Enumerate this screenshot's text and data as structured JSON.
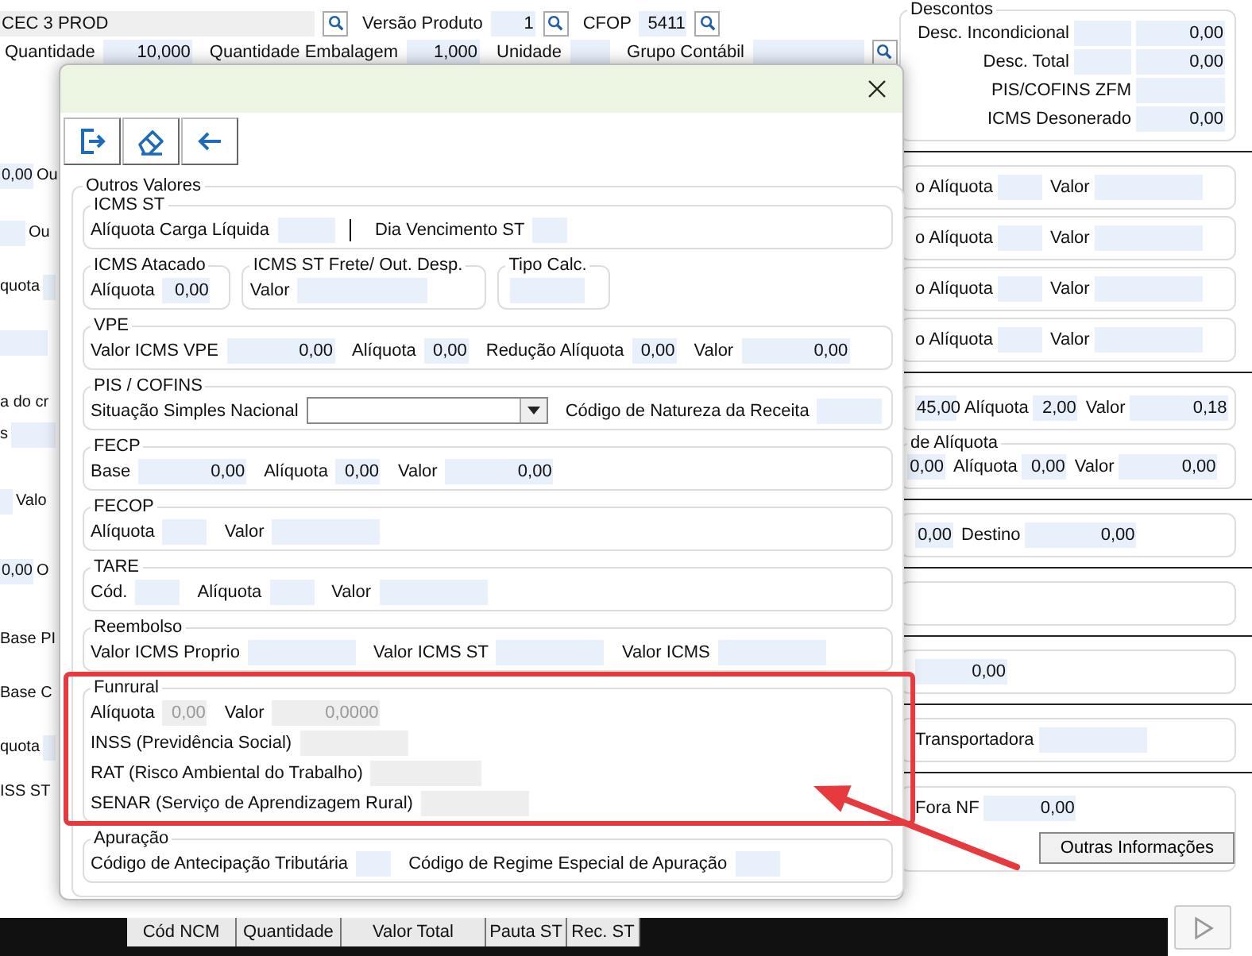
{
  "top_rows": [
    [
      {
        "kind": "field",
        "value": "CEC 3 PROD"
      },
      {
        "kind": "search"
      },
      {
        "kind": "label",
        "text": "Versão Produto"
      },
      {
        "kind": "field",
        "value": "1"
      },
      {
        "kind": "search"
      },
      {
        "kind": "label",
        "text": "CFOP"
      },
      {
        "kind": "field",
        "value": "5411"
      },
      {
        "kind": "search"
      }
    ],
    [
      {
        "kind": "label",
        "text": "Quantidade"
      },
      {
        "kind": "field",
        "value": "10,000"
      },
      {
        "kind": "label",
        "text": "Quantidade Embalagem"
      },
      {
        "kind": "field",
        "value": "1,000"
      },
      {
        "kind": "label",
        "text": "Unidade"
      },
      {
        "kind": "field"
      },
      {
        "kind": "label",
        "text": "Grupo Contábil"
      },
      {
        "kind": "field"
      },
      {
        "kind": "search"
      }
    ]
  ],
  "left_strip": [
    [
      {
        "kind": "field",
        "value": "0,00"
      },
      {
        "kind": "label",
        "text": "Ou"
      }
    ],
    [
      {
        "kind": "field"
      },
      {
        "kind": "label",
        "text": "Ou"
      }
    ],
    [
      {
        "kind": "label",
        "text": "quota"
      },
      {
        "kind": "field"
      }
    ],
    [
      {
        "kind": "field"
      }
    ],
    [
      {
        "kind": "label",
        "text": "a do cr"
      }
    ],
    [
      {
        "kind": "label",
        "text": "s"
      },
      {
        "kind": "field"
      }
    ],
    [
      {
        "kind": "field"
      },
      {
        "kind": "label",
        "text": "Valo"
      }
    ],
    [
      {
        "kind": "field",
        "value": "0,00"
      },
      {
        "kind": "label",
        "text": "O"
      }
    ],
    [
      {
        "kind": "label",
        "text": "Base PI"
      }
    ],
    [
      {
        "kind": "label",
        "text": "Base C"
      }
    ],
    [
      {
        "kind": "label",
        "text": "quota"
      },
      {
        "kind": "field"
      }
    ],
    [
      {
        "kind": "label",
        "text": "ISS ST"
      }
    ]
  ],
  "right_panel": [
    {
      "kind": "group",
      "title": "Descontos",
      "rows": [
        [
          {
            "kind": "label",
            "text": "Desc. Incondicional"
          },
          {
            "kind": "field"
          },
          {
            "kind": "field",
            "value": "0,00"
          }
        ],
        [
          {
            "kind": "label",
            "text": "Desc. Total"
          },
          {
            "kind": "field"
          },
          {
            "kind": "field",
            "value": "0,00"
          }
        ],
        [
          {
            "kind": "label",
            "text": "PIS/COFINS ZFM"
          },
          {
            "kind": "field"
          }
        ],
        [
          {
            "kind": "label",
            "text": "ICMS Desonerado"
          },
          {
            "kind": "field",
            "value": "0,00"
          }
        ]
      ]
    },
    {
      "kind": "rule"
    },
    {
      "kind": "box",
      "rows": [
        [
          {
            "kind": "label",
            "text": "o Alíquota"
          },
          {
            "kind": "field"
          },
          {
            "kind": "label",
            "text": "Valor"
          },
          {
            "kind": "field"
          }
        ]
      ]
    },
    {
      "kind": "box",
      "rows": [
        [
          {
            "kind": "label",
            "text": "o Alíquota"
          },
          {
            "kind": "field"
          },
          {
            "kind": "label",
            "text": "Valor"
          },
          {
            "kind": "field"
          }
        ]
      ]
    },
    {
      "kind": "box",
      "rows": [
        [
          {
            "kind": "label",
            "text": "o Alíquota"
          },
          {
            "kind": "field"
          },
          {
            "kind": "label",
            "text": "Valor"
          },
          {
            "kind": "field"
          }
        ]
      ]
    },
    {
      "kind": "box",
      "rows": [
        [
          {
            "kind": "label",
            "text": "o Alíquota"
          },
          {
            "kind": "field"
          },
          {
            "kind": "label",
            "text": "Valor"
          },
          {
            "kind": "field"
          }
        ]
      ]
    },
    {
      "kind": "rule"
    },
    {
      "kind": "box",
      "rows": [
        [
          {
            "kind": "field",
            "value": "45,00"
          },
          {
            "kind": "label",
            "text": "Alíquota"
          },
          {
            "kind": "field",
            "value": "2,00"
          },
          {
            "kind": "label",
            "text": "Valor"
          },
          {
            "kind": "field",
            "value": "0,18"
          }
        ]
      ]
    },
    {
      "kind": "group",
      "title": "de Alíquota",
      "rows": [
        [
          {
            "kind": "field",
            "value": "0,00"
          },
          {
            "kind": "label",
            "text": "Alíquota"
          },
          {
            "kind": "field",
            "value": "0,00"
          },
          {
            "kind": "label",
            "text": "Valor"
          },
          {
            "kind": "field",
            "value": "0,00"
          }
        ]
      ]
    },
    {
      "kind": "rule"
    },
    {
      "kind": "box",
      "rows": [
        [
          {
            "kind": "field",
            "value": "0,00"
          },
          {
            "kind": "label",
            "text": "Destino"
          },
          {
            "kind": "field",
            "value": "0,00"
          }
        ]
      ]
    },
    {
      "kind": "rule"
    },
    {
      "kind": "box"
    },
    {
      "kind": "rule"
    },
    {
      "kind": "box",
      "rows": [
        [
          {
            "kind": "field",
            "value": "0,00"
          }
        ]
      ]
    },
    {
      "kind": "rule"
    },
    {
      "kind": "box",
      "rows": [
        [
          {
            "kind": "label",
            "text": "Transportadora"
          },
          {
            "kind": "field"
          }
        ]
      ]
    },
    {
      "kind": "rule"
    },
    {
      "kind": "box",
      "rows": [
        [
          {
            "kind": "label",
            "text": "Fora NF"
          },
          {
            "kind": "field",
            "value": "0,00"
          }
        ]
      ],
      "button": {
        "text": "Outras Informações"
      }
    }
  ],
  "table": {
    "columns": [
      "Cód NCM",
      "Quantidade",
      "Valor Total",
      "Pauta ST",
      "Rec. ST"
    ]
  },
  "dialog": {
    "toolbar": [
      {
        "kind": "exit"
      },
      {
        "kind": "eraser"
      },
      {
        "kind": "back"
      }
    ],
    "group_title": "Outros Valores",
    "sections": [
      {
        "kind": "box",
        "title": "ICMS ST",
        "disabled": false,
        "rows": [
          [
            {
              "kind": "label",
              "text": "Alíquota Carga Líquida"
            },
            {
              "kind": "field"
            },
            {
              "kind": "divider"
            },
            {
              "kind": "label",
              "text": "Dia Vencimento ST"
            },
            {
              "kind": "field"
            }
          ]
        ]
      },
      {
        "kind": "boxes",
        "disabled": false,
        "boxes": [
          {
            "title": "ICMS Atacado",
            "rows": [
              [
                {
                  "kind": "label",
                  "text": "Alíquota"
                },
                {
                  "kind": "field",
                  "value": "0,00"
                }
              ]
            ]
          },
          {
            "title": "ICMS ST Frete/ Out. Desp.",
            "rows": [
              [
                {
                  "kind": "label",
                  "text": "Valor"
                },
                {
                  "kind": "field"
                }
              ]
            ]
          },
          {
            "title": "Tipo Calc.",
            "rows": [
              [
                {
                  "kind": "field"
                }
              ]
            ]
          }
        ]
      },
      {
        "kind": "box",
        "title": "VPE",
        "disabled": false,
        "rows": [
          [
            {
              "kind": "label",
              "text": "Valor ICMS VPE"
            },
            {
              "kind": "field",
              "value": "0,00"
            },
            {
              "kind": "label",
              "text": "Alíquota"
            },
            {
              "kind": "field",
              "value": "0,00"
            },
            {
              "kind": "label",
              "text": "Redução Alíquota"
            },
            {
              "kind": "field",
              "value": "0,00"
            },
            {
              "kind": "label",
              "text": "Valor"
            },
            {
              "kind": "field",
              "value": "0,00"
            }
          ]
        ]
      },
      {
        "kind": "box",
        "title": "PIS / COFINS",
        "disabled": false,
        "rows": [
          [
            {
              "kind": "label",
              "text": "Situação Simples Nacional"
            },
            {
              "kind": "select"
            },
            {
              "kind": "label",
              "text": "Código de Natureza da Receita"
            },
            {
              "kind": "field"
            }
          ]
        ]
      },
      {
        "kind": "box",
        "title": "FECP",
        "disabled": false,
        "rows": [
          [
            {
              "kind": "label",
              "text": "Base"
            },
            {
              "kind": "field",
              "value": "0,00"
            },
            {
              "kind": "label",
              "text": "Alíquota"
            },
            {
              "kind": "field",
              "value": "0,00"
            },
            {
              "kind": "label",
              "text": "Valor"
            },
            {
              "kind": "field",
              "value": "0,00"
            }
          ]
        ]
      },
      {
        "kind": "box",
        "title": "FECOP",
        "disabled": false,
        "rows": [
          [
            {
              "kind": "label",
              "text": "Alíquota"
            },
            {
              "kind": "field"
            },
            {
              "kind": "label",
              "text": "Valor"
            },
            {
              "kind": "field"
            }
          ]
        ]
      },
      {
        "kind": "box",
        "title": "TARE",
        "disabled": false,
        "rows": [
          [
            {
              "kind": "label",
              "text": "Cód."
            },
            {
              "kind": "field"
            },
            {
              "kind": "label",
              "text": "Alíquota"
            },
            {
              "kind": "field"
            },
            {
              "kind": "label",
              "text": "Valor"
            },
            {
              "kind": "field"
            }
          ]
        ]
      },
      {
        "kind": "box",
        "title": "Reembolso",
        "disabled": false,
        "rows": [
          [
            {
              "kind": "label",
              "text": "Valor ICMS Proprio"
            },
            {
              "kind": "field"
            },
            {
              "kind": "label",
              "text": "Valor ICMS ST"
            },
            {
              "kind": "field"
            },
            {
              "kind": "label",
              "text": "Valor ICMS"
            },
            {
              "kind": "field"
            }
          ]
        ]
      },
      {
        "kind": "box",
        "title": "Funrural",
        "disabled": true,
        "highlighted": true,
        "rows": [
          [
            {
              "kind": "label",
              "text": "Alíquota"
            },
            {
              "kind": "field",
              "value": "0,00"
            },
            {
              "kind": "label",
              "text": "Valor"
            },
            {
              "kind": "field",
              "value": "0,0000"
            }
          ],
          [
            {
              "kind": "label",
              "text": "INSS (Previdência Social)"
            },
            {
              "kind": "field"
            }
          ],
          [
            {
              "kind": "label",
              "text": "RAT (Risco Ambiental do Trabalho)"
            },
            {
              "kind": "field"
            }
          ],
          [
            {
              "kind": "label",
              "text": "SENAR (Serviço de Aprendizagem Rural)"
            },
            {
              "kind": "field"
            }
          ]
        ]
      },
      {
        "kind": "box",
        "title": "Apuração",
        "disabled": false,
        "rows": [
          [
            {
              "kind": "label",
              "text": "Código de Antecipação Tributária"
            },
            {
              "kind": "field"
            },
            {
              "kind": "label",
              "text": "Código de Regime Especial de Apuração"
            },
            {
              "kind": "field"
            }
          ]
        ]
      }
    ]
  }
}
